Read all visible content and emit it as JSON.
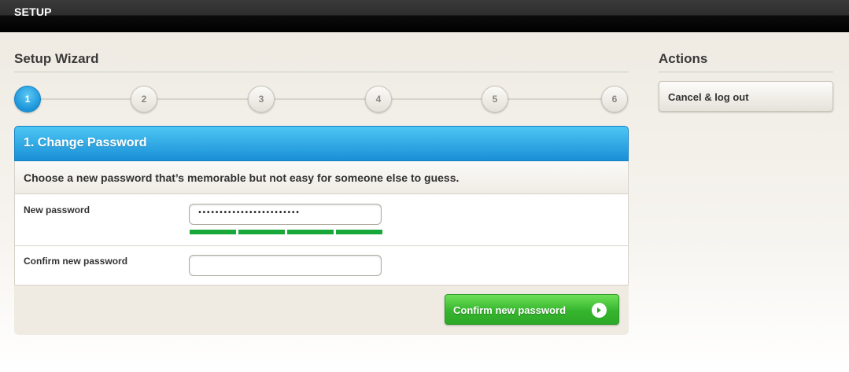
{
  "topbar": {
    "title": "SETUP"
  },
  "wizard": {
    "title": "Setup Wizard",
    "steps": [
      {
        "label": "1",
        "active": true
      },
      {
        "label": "2",
        "active": false
      },
      {
        "label": "3",
        "active": false
      },
      {
        "label": "4",
        "active": false
      },
      {
        "label": "5",
        "active": false
      },
      {
        "label": "6",
        "active": false
      }
    ]
  },
  "panel": {
    "title": "1. Change Password",
    "intro": "Choose a new password that’s memorable but not easy for someone else to guess.",
    "new_password": {
      "label": "New password",
      "value": "••••••••••••••••••••••••",
      "strength_segments_filled": 4,
      "strength_segments_total": 4,
      "strength_color": "#18a83a"
    },
    "confirm_password": {
      "label": "Confirm new password",
      "value": ""
    },
    "confirm_button": {
      "label": "Confirm new password",
      "icon": "arrow-right-circle-icon"
    }
  },
  "actions": {
    "title": "Actions",
    "cancel_button": {
      "label": "Cancel & log out"
    }
  },
  "colors": {
    "accent_blue": "#1a8fd7",
    "confirm_green": "#36b52e",
    "background": "#f1eee7"
  }
}
